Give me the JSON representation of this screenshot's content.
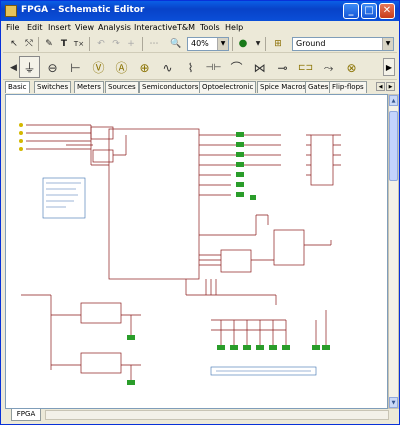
{
  "window": {
    "title": "FPGA - Schematic Editor",
    "controls": {
      "minimize": "_",
      "maximize": "□",
      "close": "✕"
    }
  },
  "menu": [
    "File",
    "Edit",
    "Insert",
    "View",
    "Analysis",
    "Interactive",
    "T&M",
    "Tools",
    "Help"
  ],
  "toolbar": {
    "zoom_value": "40%",
    "ground_value": "Ground",
    "tools": [
      {
        "name": "pointer-icon",
        "glyph": "↖"
      },
      {
        "name": "wire-tool-icon",
        "glyph": "⤲"
      },
      {
        "name": "pencil-icon",
        "glyph": "✎"
      },
      {
        "name": "text-tool-icon",
        "glyph": "T"
      },
      {
        "name": "variable-text-icon",
        "glyph": "T×"
      },
      {
        "name": "undo-icon",
        "glyph": "↶"
      },
      {
        "name": "redo-icon",
        "glyph": "↷"
      },
      {
        "name": "plus-icon",
        "glyph": "+"
      },
      {
        "name": "grid-icon",
        "glyph": "⋯"
      },
      {
        "name": "zoom-icon",
        "glyph": "🔍"
      }
    ]
  },
  "components": [
    {
      "name": "ground-symbol-icon",
      "glyph": "⏚"
    },
    {
      "name": "ac-source-icon",
      "glyph": "⊖"
    },
    {
      "name": "battery-icon",
      "glyph": "⊢"
    },
    {
      "name": "voltmeter-icon",
      "glyph": "Ⓥ"
    },
    {
      "name": "ammeter-icon",
      "glyph": "Ⓐ"
    },
    {
      "name": "lamp-source-icon",
      "glyph": "⊕"
    },
    {
      "name": "resistor-icon",
      "glyph": "∿"
    },
    {
      "name": "variable-resistor-icon",
      "glyph": "⌇"
    },
    {
      "name": "capacitor-icon",
      "glyph": "⊣⊢"
    },
    {
      "name": "inductor-icon",
      "glyph": "⌒"
    },
    {
      "name": "transformer-icon",
      "glyph": "⋈"
    },
    {
      "name": "switch-icon",
      "glyph": "⊸"
    },
    {
      "name": "fuse-icon",
      "glyph": "⊏⊐"
    },
    {
      "name": "relay-icon",
      "glyph": "⤳"
    },
    {
      "name": "bulb-icon",
      "glyph": "⊗"
    }
  ],
  "tabs": [
    "Basic",
    "Switches",
    "Meters",
    "Sources",
    "Semiconductors",
    "Optoelectronic",
    "Spice Macros",
    "Gates",
    "Flip-flops"
  ],
  "sheet_tab": "FPGA"
}
